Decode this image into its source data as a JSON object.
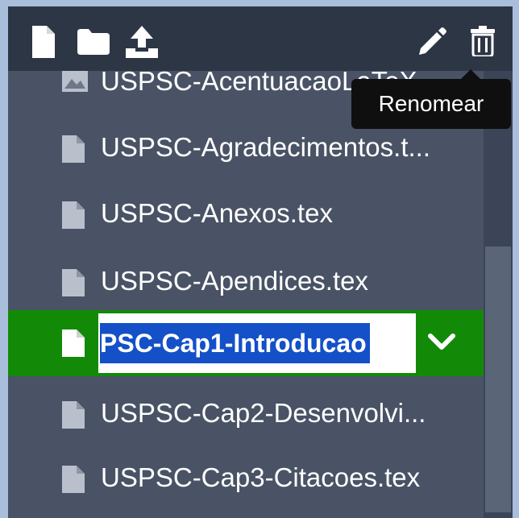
{
  "toolbar": {
    "new_file_icon": "new-file-icon",
    "new_folder_icon": "new-folder-icon",
    "upload_icon": "upload-icon",
    "rename_icon": "pencil-icon",
    "delete_icon": "trash-icon"
  },
  "tooltip": {
    "text": "Renomear"
  },
  "files": [
    {
      "name": "USPSC-AcentuacaoLaTeX",
      "icon": "image-file-icon",
      "state": "partially-visible"
    },
    {
      "name": "USPSC-Agradecimentos.t...",
      "icon": "file-icon"
    },
    {
      "name": "USPSC-Anexos.tex",
      "icon": "file-icon"
    },
    {
      "name": "USPSC-Apendices.tex",
      "icon": "file-icon"
    },
    {
      "name": "PSC-Cap1-Introducao",
      "icon": "file-icon",
      "state": "renaming"
    },
    {
      "name": "USPSC-Cap2-Desenvolvi...",
      "icon": "file-icon"
    },
    {
      "name": "USPSC-Cap3-Citacoes.tex",
      "icon": "file-icon"
    }
  ],
  "colors": {
    "toolbar_bg": "#2d3644",
    "panel_bg": "#495365",
    "selected_bg": "#138a07",
    "text_selection": "#1450c8",
    "tooltip_bg": "#0f0f0f"
  }
}
